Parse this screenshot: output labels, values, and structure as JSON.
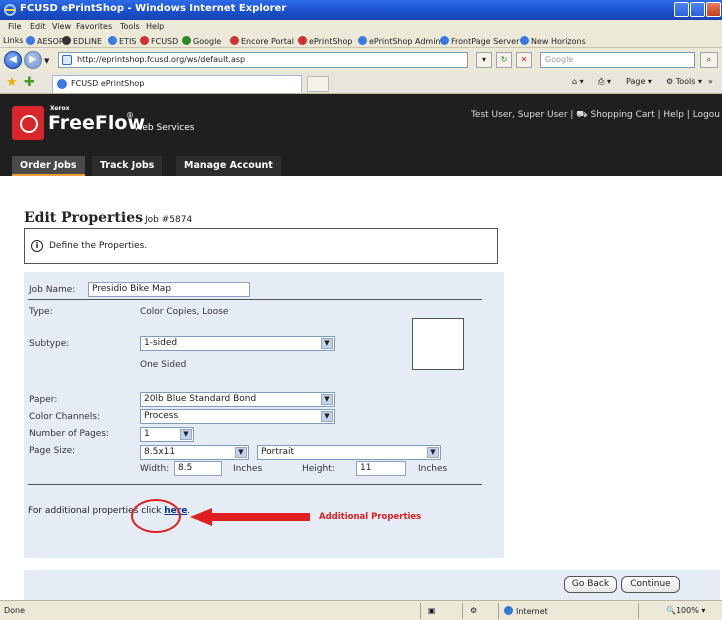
{
  "window": {
    "title": "FCUSD ePrintShop - Windows Internet Explorer"
  },
  "menu": [
    "File",
    "Edit",
    "View",
    "Favorites",
    "Tools",
    "Help"
  ],
  "links_bar": {
    "label": "Links",
    "items": [
      "AESOP",
      "EDLINE",
      "ETIS",
      "FCUSD",
      "Google",
      "Encore Portal",
      "ePrintShop",
      "ePrintShop Admin",
      "FrontPage Server",
      "New Horizons"
    ]
  },
  "address": {
    "url": "http://eprintshop.fcusd.org/ws/default.asp",
    "search_placeholder": "Google"
  },
  "tabs_bar": {
    "tab_title": "FCUSD ePrintShop",
    "page_menu": "Page",
    "tools_menu": "Tools"
  },
  "app": {
    "brand_small": "Xerox",
    "brand_name": "FreeFlow",
    "brand_reg": "®",
    "brand_sub": "Web Services",
    "user": "Test User, Super User",
    "cart": "Shopping Cart",
    "help": "Help",
    "logout": "Logou",
    "nav": [
      "Order Jobs",
      "Track Jobs",
      "Manage Account"
    ]
  },
  "page": {
    "title": "Edit Properties",
    "job_number": "Job #5874",
    "info_icon": "info-icon",
    "info_text": "Define the Properties."
  },
  "form": {
    "job_name_label": "Job Name:",
    "job_name_value": "Presidio Bike Map",
    "type_label": "Type:",
    "type_value": "Color Copies, Loose",
    "subtype_label": "Subtype:",
    "subtype_value": "1-sided",
    "subtype_desc": "One Sided",
    "paper_label": "Paper:",
    "paper_value": "20lb Blue Standard Bond",
    "color_label": "Color Channels:",
    "color_value": "Process",
    "pages_label": "Number of Pages:",
    "pages_value": "1",
    "size_label": "Page Size:",
    "size_value": "8.5x11",
    "orientation_value": "Portrait",
    "width_label": "Width:",
    "width_value": "8.5",
    "height_label": "Height:",
    "height_value": "11",
    "units": "Inches",
    "additional_text": "For additional properties click",
    "additional_link": "here",
    "additional_period": "."
  },
  "annotation": {
    "label": "Additional Properties",
    "color": "#e02020"
  },
  "buttons": {
    "go_back": "Go Back",
    "continue": "Continue"
  },
  "status": {
    "done": "Done",
    "zone": "Internet",
    "zoom": "100%"
  }
}
